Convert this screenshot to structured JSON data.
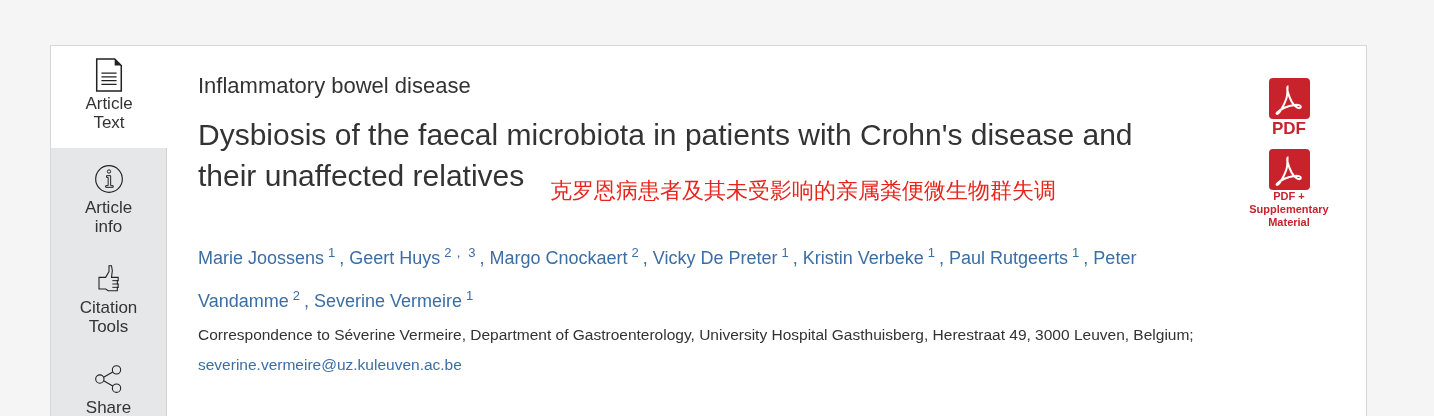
{
  "sidebar": {
    "tabs": [
      {
        "label": "Article Text",
        "selected": true
      },
      {
        "label": "Article info",
        "selected": false
      },
      {
        "label": "Citation Tools",
        "selected": false
      },
      {
        "label": "Share",
        "selected": false
      }
    ]
  },
  "article": {
    "section": "Inflammatory bowel disease",
    "title_lines": [
      "Dysbiosis of the faecal microbiota in patients with Crohn's disease and",
      "their unaffected relatives"
    ],
    "translation": "克罗恩病患者及其未受影响的亲属粪便微生物群失调",
    "authors": [
      {
        "name": "Marie Joossens",
        "aff": "1",
        "sep": ","
      },
      {
        "name": "Geert Huys",
        "aff": "2， 3",
        "sep": ","
      },
      {
        "name": "Margo Cnockaert",
        "aff": "2",
        "sep": ","
      },
      {
        "name": "Vicky De Preter",
        "aff": "1",
        "sep": ","
      },
      {
        "name": "Kristin Verbeke",
        "aff": "1",
        "sep": ","
      },
      {
        "name": "Paul Rutgeerts",
        "aff": "1",
        "sep": ","
      },
      {
        "name": "Peter",
        "name_continued": "Vandamme",
        "aff": "2",
        "sep": ","
      },
      {
        "name": "Severine Vermeire",
        "aff": "1"
      }
    ],
    "correspondence": "Correspondence to Séverine Vermeire, Department of Gastroenterology, University Hospital Gasthuisberg, Herestraat 49, 3000 Leuven, Belgium;",
    "email": "severine.vermeire@uz.kuleuven.ac.be"
  },
  "downloads": [
    {
      "label": "PDF",
      "kind": "large"
    },
    {
      "label": "PDF + Supplementary Material",
      "kind": "small"
    }
  ]
}
